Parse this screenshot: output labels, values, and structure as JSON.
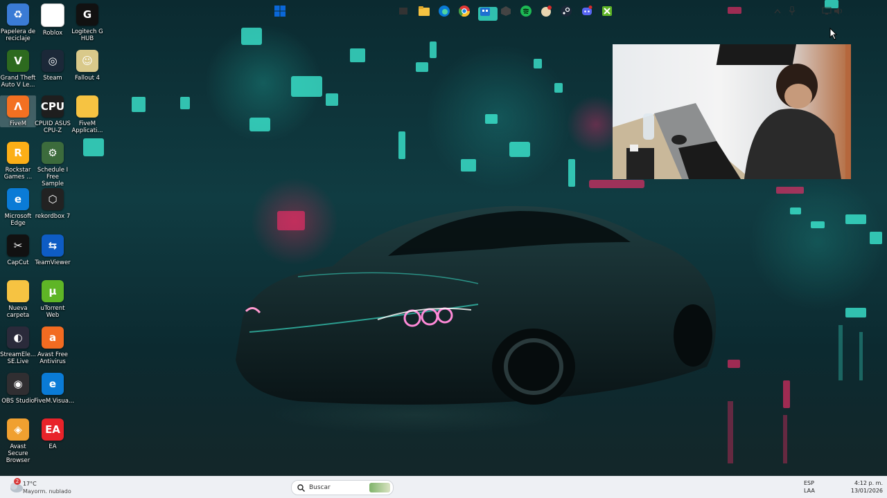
{
  "desktop_icons": [
    {
      "label": "Papelera de reciclaje",
      "glyph": "♻",
      "color": "#3a7bd5",
      "icon": "recycle-bin-icon"
    },
    {
      "label": "Roblox",
      "glyph": "",
      "color": "#ffffff",
      "icon": "roblox-file-icon"
    },
    {
      "label": "Logitech G HUB",
      "glyph": "G",
      "color": "#111111",
      "icon": "logitech-g-hub-icon"
    },
    {
      "label": "Grand Theft Auto V Le...",
      "glyph": "V",
      "color": "#2d6a1f",
      "icon": "gta-v-icon"
    },
    {
      "label": "Steam",
      "glyph": "◎",
      "color": "#1b2838",
      "icon": "steam-icon"
    },
    {
      "label": "Fallout 4",
      "glyph": "☺",
      "color": "#d9c98a",
      "icon": "fallout-4-icon"
    },
    {
      "label": "FiveM",
      "glyph": "Λ",
      "color": "#f37021",
      "icon": "fivem-icon"
    },
    {
      "label": "CPUID ASUS CPU-Z",
      "glyph": "CPU",
      "color": "#1e1e1e",
      "icon": "cpu-z-icon"
    },
    {
      "label": "FiveM Applicati...",
      "glyph": "",
      "color": "#f6c342",
      "icon": "folder-icon"
    },
    {
      "label": "Rockstar Games ...",
      "glyph": "R",
      "color": "#fcaf17",
      "icon": "rockstar-icon"
    },
    {
      "label": "Schedule I Free Sample",
      "glyph": "⚙",
      "color": "#3c6b3c",
      "icon": "schedule-i-icon"
    },
    {
      "label": "",
      "glyph": "",
      "color": "",
      "icon": ""
    },
    {
      "label": "Microsoft Edge",
      "glyph": "e",
      "color": "#0a7bd6",
      "icon": "edge-icon"
    },
    {
      "label": "rekordbox 7",
      "glyph": "⬡",
      "color": "#222222",
      "icon": "rekordbox-icon"
    },
    {
      "label": "",
      "glyph": "",
      "color": "",
      "icon": ""
    },
    {
      "label": "CapCut",
      "glyph": "✂",
      "color": "#111111",
      "icon": "capcut-icon"
    },
    {
      "label": "TeamViewer",
      "glyph": "⇆",
      "color": "#0e5cc4",
      "icon": "teamviewer-icon"
    },
    {
      "label": "",
      "glyph": "",
      "color": "",
      "icon": ""
    },
    {
      "label": "Nueva carpeta",
      "glyph": "",
      "color": "#f6c342",
      "icon": "folder-icon"
    },
    {
      "label": "uTorrent Web",
      "glyph": "µ",
      "color": "#5fb526",
      "icon": "utorrent-icon"
    },
    {
      "label": "",
      "glyph": "",
      "color": "",
      "icon": ""
    },
    {
      "label": "StreamEle... SE.Live",
      "glyph": "◐",
      "color": "#2a2a3a",
      "icon": "streamelements-icon"
    },
    {
      "label": "Avast Free Antivirus",
      "glyph": "a",
      "color": "#f26b21",
      "icon": "avast-icon"
    },
    {
      "label": "",
      "glyph": "",
      "color": "",
      "icon": ""
    },
    {
      "label": "OBS Studio",
      "glyph": "◉",
      "color": "#302e31",
      "icon": "obs-icon"
    },
    {
      "label": "FiveM.Visua...",
      "glyph": "e",
      "color": "#0a7bd6",
      "icon": "edge-icon"
    },
    {
      "label": "",
      "glyph": "",
      "color": "",
      "icon": ""
    },
    {
      "label": "Avast Secure Browser",
      "glyph": "◈",
      "color": "#f0a030",
      "icon": "avast-browser-icon"
    },
    {
      "label": "EA",
      "glyph": "EA",
      "color": "#e8232a",
      "icon": "ea-icon"
    }
  ],
  "weather": {
    "temp": "17°C",
    "desc": "Mayorm. nublado",
    "badge": "2"
  },
  "search": {
    "placeholder": "Buscar"
  },
  "tray": {
    "lang1": "ESP",
    "lang2": "LAA",
    "time": "4:12 p. m.",
    "date": "13/01/2026"
  },
  "colors": {
    "taskbar_bg": "#eef0f4",
    "accent": "#0a67d8"
  }
}
